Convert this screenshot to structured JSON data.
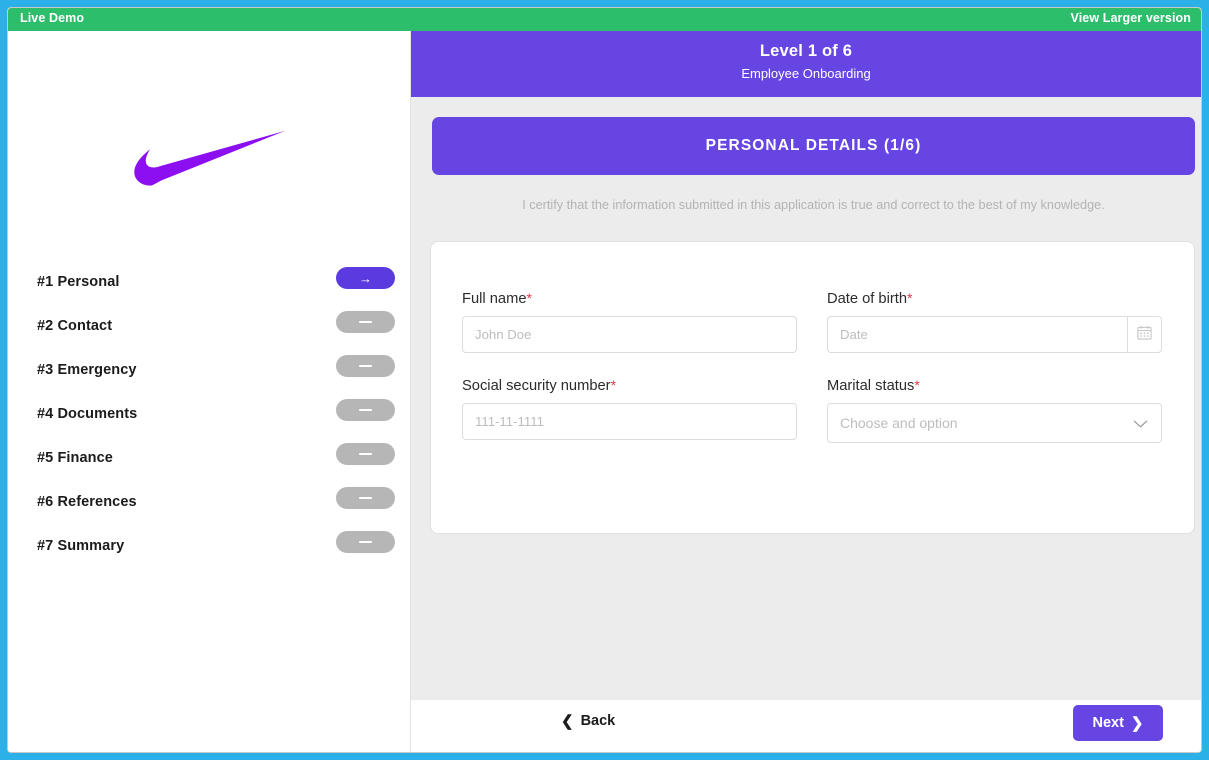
{
  "colors": {
    "frame": "#2BB0E8",
    "live_bar": "#2DBE6C",
    "purple": "#6645E3",
    "pill_active": "#5B3BE0",
    "pill_inactive": "#b6b6b6",
    "logo_purple": "#8B0FF0",
    "panel_bg": "#ECECEC",
    "required_star": "#e0394a"
  },
  "topbar": {
    "live_demo_label": "Live Demo",
    "view_larger_label": "View Larger version"
  },
  "sidebar": {
    "logo_name": "nike-swoosh-logo",
    "steps": [
      {
        "label": "#1 Personal",
        "state": "active",
        "glyph": "→"
      },
      {
        "label": "#2 Contact",
        "state": "inactive",
        "glyph": "–"
      },
      {
        "label": "#3 Emergency",
        "state": "inactive",
        "glyph": "–"
      },
      {
        "label": "#4 Documents",
        "state": "inactive",
        "glyph": "–"
      },
      {
        "label": "#5 Finance",
        "state": "inactive",
        "glyph": "–"
      },
      {
        "label": "#6 References",
        "state": "inactive",
        "glyph": "–"
      },
      {
        "label": "#7 Summary",
        "state": "inactive",
        "glyph": "–"
      }
    ]
  },
  "panel": {
    "header": {
      "level_title": "Level 1 of 6",
      "subtitle": "Employee Onboarding"
    },
    "section_banner": "PERSONAL DETAILS (1/6)",
    "certify_note": "I certify that the information submitted in this application is true and correct to the best of my knowledge.",
    "fields": {
      "full_name": {
        "label": "Full name",
        "required": "*",
        "value": "",
        "placeholder": "John Doe"
      },
      "date_of_birth": {
        "label": "Date of birth",
        "required": "*",
        "value": "",
        "placeholder": "Date",
        "addon_icon": "calendar-icon"
      },
      "ssn": {
        "label": "Social security number",
        "required": "*",
        "value": "",
        "placeholder": "111-11-1111"
      },
      "marital_status": {
        "label": "Marital status",
        "required": "*",
        "selected": "Choose and option",
        "caret_icon": "chevron-down-icon"
      }
    },
    "footer": {
      "back_label": "Back",
      "back_icon": "chevron-left-icon",
      "next_label": "Next",
      "next_icon": "chevron-right-icon"
    }
  }
}
